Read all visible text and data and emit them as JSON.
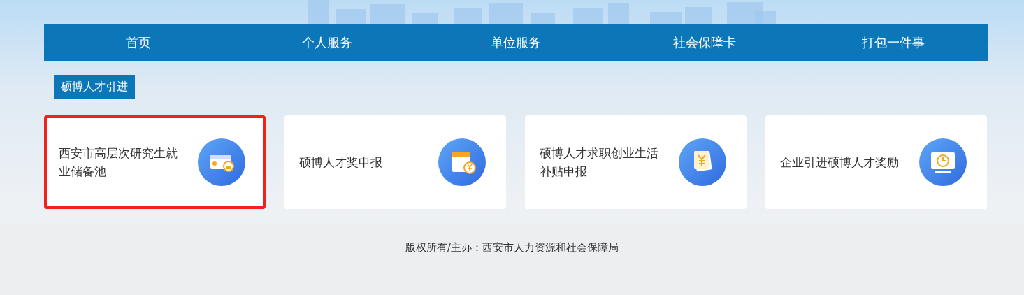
{
  "nav": [
    {
      "label": "首页"
    },
    {
      "label": "个人服务"
    },
    {
      "label": "单位服务"
    },
    {
      "label": "社会保障卡"
    },
    {
      "label": "打包一件事"
    }
  ],
  "section": {
    "title": "硕博人才引进"
  },
  "cards": [
    {
      "label": "西安市高层次研究生就业储备池",
      "kind": "card",
      "selected": true
    },
    {
      "label": "硕博人才奖申报",
      "kind": "calendar",
      "selected": false
    },
    {
      "label": "硕博人才求职创业生活补贴申报",
      "kind": "money",
      "selected": false
    },
    {
      "label": "企业引进硕博人才奖励",
      "kind": "monitor",
      "selected": false
    }
  ],
  "footer": {
    "copyright": "版权所有/主办：西安市人力资源和社会保障局"
  }
}
